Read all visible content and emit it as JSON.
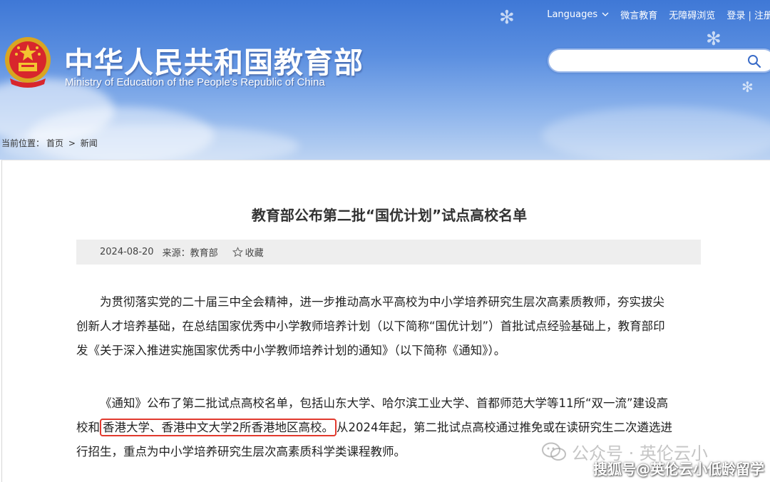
{
  "header": {
    "links": [
      "Languages",
      "微言教育",
      "无障碍浏览",
      "登录",
      "注册"
    ],
    "title": "中华人民共和国教育部",
    "subtitle": "Ministry of Education of the People's Republic of China",
    "search": {
      "value": "",
      "placeholder": ""
    }
  },
  "breadcrumb": {
    "label": "当前位置：",
    "home": "首页",
    "separator": ">",
    "current": "新闻"
  },
  "article": {
    "title": "教育部公布第二批“国优计划”试点高校名单",
    "date": "2024-08-20",
    "source_label": "来源：",
    "source": "教育部",
    "bookmark": "收藏",
    "p1_lines": [
      "为贯彻落实党的二十届三中全会精神，进一步推动高水平高校为中小学培养研究生层次高素质教师，夯实拔尖",
      "创新人才培养基础，在总结国家优秀中小学教师培养计划（以下简称“国优计划”）首批试点经验基础上，教育部印",
      "发《关于深入推进实施国家优秀中小学教师培养计划的通知》（以下简称《通知》）。"
    ],
    "p2_line1": "《通知》公布了第二批试点高校名单，包括山东大学、哈尔滨工业大学、首都师范大学等11所“双一流”建设高",
    "p2_line2_pre": "校和",
    "p2_line2_highlight": "香港大学、香港中文大学2所香港地区高校。",
    "p2_line2_post": "从2024年起，第二批试点高校通过推免或在读研究生二次遴选进",
    "p2_line3": "行招生，重点为中小学培养研究生层次高素质科学类课程教师。"
  },
  "watermarks": {
    "wechat": "公众号 · 英伦云小",
    "sohu": "搜狐号@英伦云小低龄留学"
  },
  "colors": {
    "banner_top": "#3f78d6",
    "highlight_border": "#e23a2e",
    "meta_bg": "#eeeeee"
  },
  "icons": [
    "national-emblem-icon",
    "chevron-down-icon",
    "search-icon",
    "star-icon",
    "wechat-icon"
  ]
}
